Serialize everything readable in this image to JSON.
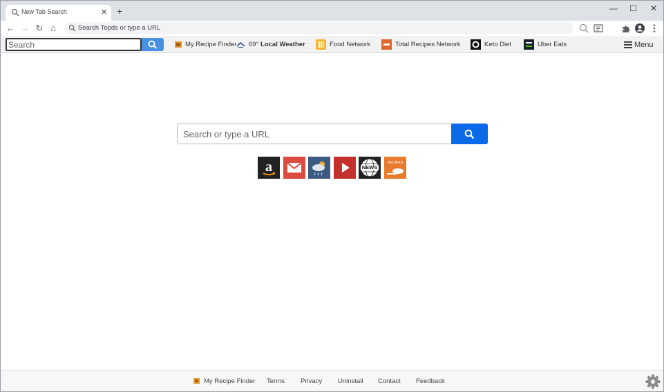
{
  "tab": {
    "title": "New Tab Search",
    "close_glyph": "✕"
  },
  "new_tab_glyph": "+",
  "window_controls": {
    "minimize": "—",
    "maximize": "☐",
    "close": "✕"
  },
  "toolbar": {
    "back_glyph": "←",
    "forward_glyph": "→",
    "reload_glyph": "↻",
    "home_glyph": "⌂",
    "omnibox_text": "Search Topds or type a URL"
  },
  "extension_bar": {
    "search_placeholder": "Search",
    "links": [
      {
        "label": "My Recipe Finder",
        "icon": "recipe-finder-icon"
      },
      {
        "label_prefix": "69°",
        "label": "Local Weather",
        "icon": "weather-icon"
      },
      {
        "label": "Food Network",
        "icon": "food-network-icon"
      },
      {
        "label": "Total Recipes Network",
        "icon": "total-recipes-icon"
      },
      {
        "label": "Keto Diet",
        "icon": "keto-diet-icon"
      },
      {
        "label": "Uber Eats",
        "icon": "uber-eats-icon"
      }
    ],
    "menu_label": "Menu"
  },
  "main_search": {
    "placeholder": "Search or type a URL"
  },
  "tiles": [
    {
      "name": "amazon",
      "icon": "amazon-icon"
    },
    {
      "name": "gmail",
      "icon": "gmail-icon"
    },
    {
      "name": "weather",
      "icon": "weather-tile-icon"
    },
    {
      "name": "youtube",
      "icon": "youtube-icon"
    },
    {
      "name": "news",
      "icon": "news-icon",
      "text": "NEWS"
    },
    {
      "name": "recipes",
      "icon": "recipes-icon",
      "text": "RECIPES"
    }
  ],
  "footer": {
    "links": [
      "My Recipe Finder",
      "Terms",
      "Privacy",
      "Uninstall",
      "Contact",
      "Feedback"
    ]
  },
  "colors": {
    "tabstrip": "#dee1e6",
    "extbar": "#f2f2f2",
    "search_button": "#0a6ae8",
    "ext_search_button": "#4a90e2"
  }
}
